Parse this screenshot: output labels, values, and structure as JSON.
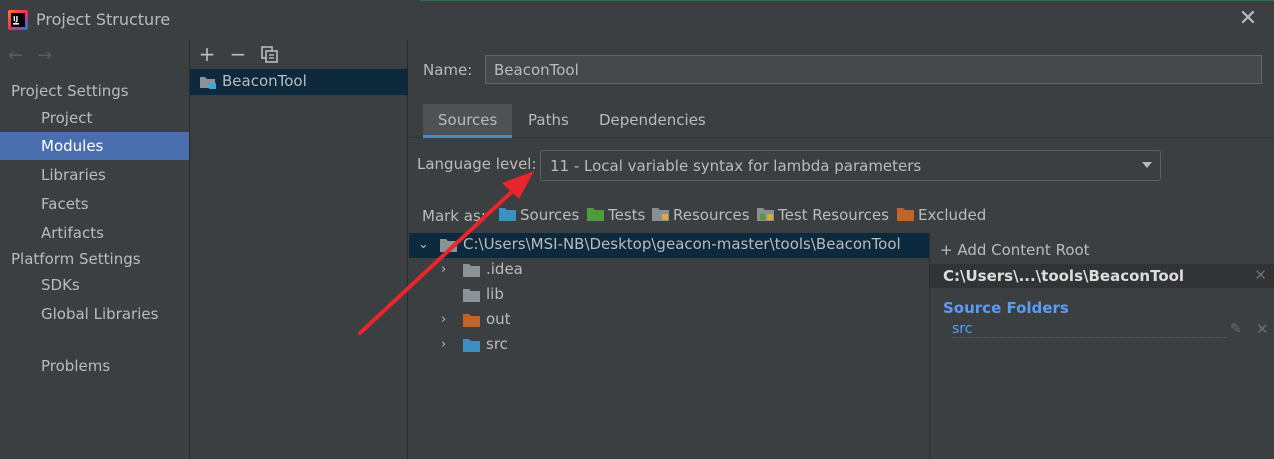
{
  "window": {
    "title": "Project Structure",
    "close_glyph": "✕",
    "icon": "intellij-idea-icon"
  },
  "nav": {
    "back_glyph": "←",
    "forward_glyph": "→",
    "project_settings_label": "Project Settings",
    "project_items": [
      {
        "label": "Project"
      },
      {
        "label": "Modules",
        "selected": true
      },
      {
        "label": "Libraries"
      },
      {
        "label": "Facets"
      },
      {
        "label": "Artifacts"
      }
    ],
    "platform_settings_label": "Platform Settings",
    "platform_items": [
      {
        "label": "SDKs"
      },
      {
        "label": "Global Libraries"
      }
    ],
    "problems_label": "Problems"
  },
  "modules": {
    "add_glyph": "+",
    "remove_glyph": "−",
    "copy_icon": "copy-icon",
    "items": [
      {
        "label": "BeaconTool"
      }
    ]
  },
  "module": {
    "name_label": "Name:",
    "name_value": "BeaconTool",
    "tabs": [
      {
        "label": "Sources",
        "active": true
      },
      {
        "label": "Paths"
      },
      {
        "label": "Dependencies"
      }
    ],
    "language_level_label": "Language level:",
    "language_level_value": "11 - Local variable syntax for lambda parameters",
    "mark_as_label": "Mark as:",
    "mark_as": [
      {
        "label": "Sources",
        "color": "#3d8fc0"
      },
      {
        "label": "Tests",
        "color": "#4e9a3c"
      },
      {
        "label": "Resources",
        "color": "#8c8f92"
      },
      {
        "label": "Test Resources",
        "color": "#8c8f92"
      },
      {
        "label": "Excluded",
        "color": "#c0652a"
      }
    ]
  },
  "tree": {
    "root": "C:\\Users\\MSI-NB\\Desktop\\geacon-master\\tools\\BeaconTool",
    "children": [
      {
        "label": ".idea",
        "expandable": true,
        "color": "#8c9296"
      },
      {
        "label": "lib",
        "expandable": false,
        "color": "#8c9296"
      },
      {
        "label": "out",
        "expandable": true,
        "color": "#c0652a"
      },
      {
        "label": "src",
        "expandable": true,
        "color": "#3d8fc0"
      }
    ]
  },
  "content_root": {
    "add_label": "+ Add Content Root",
    "root_label": "C:\\Users\\...\\tools\\BeaconTool",
    "remove_glyph": "✕",
    "source_folders_label": "Source Folders",
    "source_folders": [
      "src"
    ],
    "edit_glyph": "✎"
  },
  "colors": {
    "accent_selection": "#4b6eaf",
    "tree_selection": "#0d293e",
    "link_blue": "#589df6",
    "annotation_arrow": "#e8262b"
  }
}
